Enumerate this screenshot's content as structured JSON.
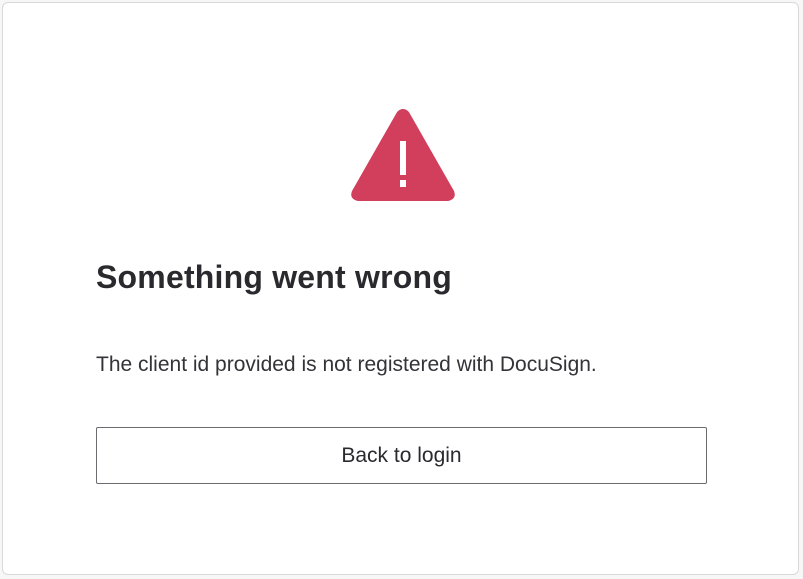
{
  "error_dialog": {
    "icon": "warning-triangle-icon",
    "icon_color": "#D13F5C",
    "title": "Something went wrong",
    "message": "The client id provided is not registered with DocuSign.",
    "back_button_label": "Back to login"
  }
}
